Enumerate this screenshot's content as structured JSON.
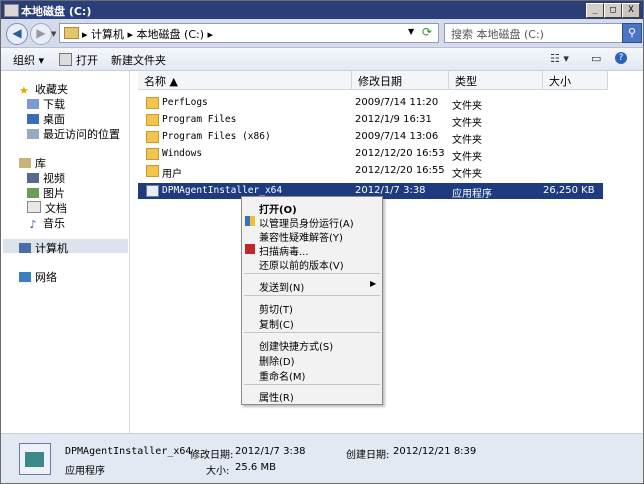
{
  "window": {
    "title": "本地磁盘 (C:)",
    "minimize": "_",
    "maximize": "□",
    "close": "X"
  },
  "address": {
    "path": "▸ 计算机 ▸ 本地磁盘 (C:) ▸",
    "search_placeholder": "搜索 本地磁盘 (C:)"
  },
  "toolbar": {
    "organize": "组织 ▾",
    "open": "打开",
    "new_folder": "新建文件夹",
    "view": "☷ ▾",
    "help": "?"
  },
  "nav": {
    "favorites": "收藏夹",
    "downloads": "下载",
    "desktop": "桌面",
    "recent": "最近访问的位置",
    "libraries": "库",
    "videos": "视频",
    "pictures": "图片",
    "documents": "文档",
    "music": "音乐",
    "computer": "计算机",
    "network": "网络"
  },
  "columns": {
    "name": "名称 ▲",
    "date": "修改日期",
    "type": "类型",
    "size": "大小"
  },
  "files": [
    {
      "name": "PerfLogs",
      "date": "2009/7/14 11:20",
      "type": "文件夹",
      "size": ""
    },
    {
      "name": "Program Files",
      "date": "2012/1/9 16:31",
      "type": "文件夹",
      "size": ""
    },
    {
      "name": "Program Files (x86)",
      "date": "2009/7/14 13:06",
      "type": "文件夹",
      "size": ""
    },
    {
      "name": "Windows",
      "date": "2012/12/20 16:53",
      "type": "文件夹",
      "size": ""
    },
    {
      "name": "用户",
      "date": "2012/12/20 16:55",
      "type": "文件夹",
      "size": ""
    },
    {
      "name": "DPMAgentInstaller_x64",
      "date": "2012/1/7 3:38",
      "type": "应用程序",
      "size": "26,250 KB"
    }
  ],
  "context_menu": {
    "open": "打开(O)",
    "run_as_admin": "以管理员身份运行(A)",
    "troubleshoot": "兼容性疑难解答(Y)",
    "scan": "扫描病毒...",
    "restore": "还原以前的版本(V)",
    "send_to": "发送到(N)",
    "cut": "剪切(T)",
    "copy": "复制(C)",
    "create_shortcut": "创建快捷方式(S)",
    "delete": "删除(D)",
    "rename": "重命名(M)",
    "properties": "属性(R)"
  },
  "details": {
    "name": "DPMAgentInstaller_x64",
    "type": "应用程序",
    "modified_label": "修改日期:",
    "modified": "2012/1/7 3:38",
    "created_label": "创建日期:",
    "created": "2012/12/21 8:39",
    "size_label": "大小:",
    "size": "25.6 MB"
  },
  "colors": {
    "title_bar": "#2a3f7a",
    "selection": "#1d3b7e",
    "menu_bg": "#f2f2f2"
  }
}
